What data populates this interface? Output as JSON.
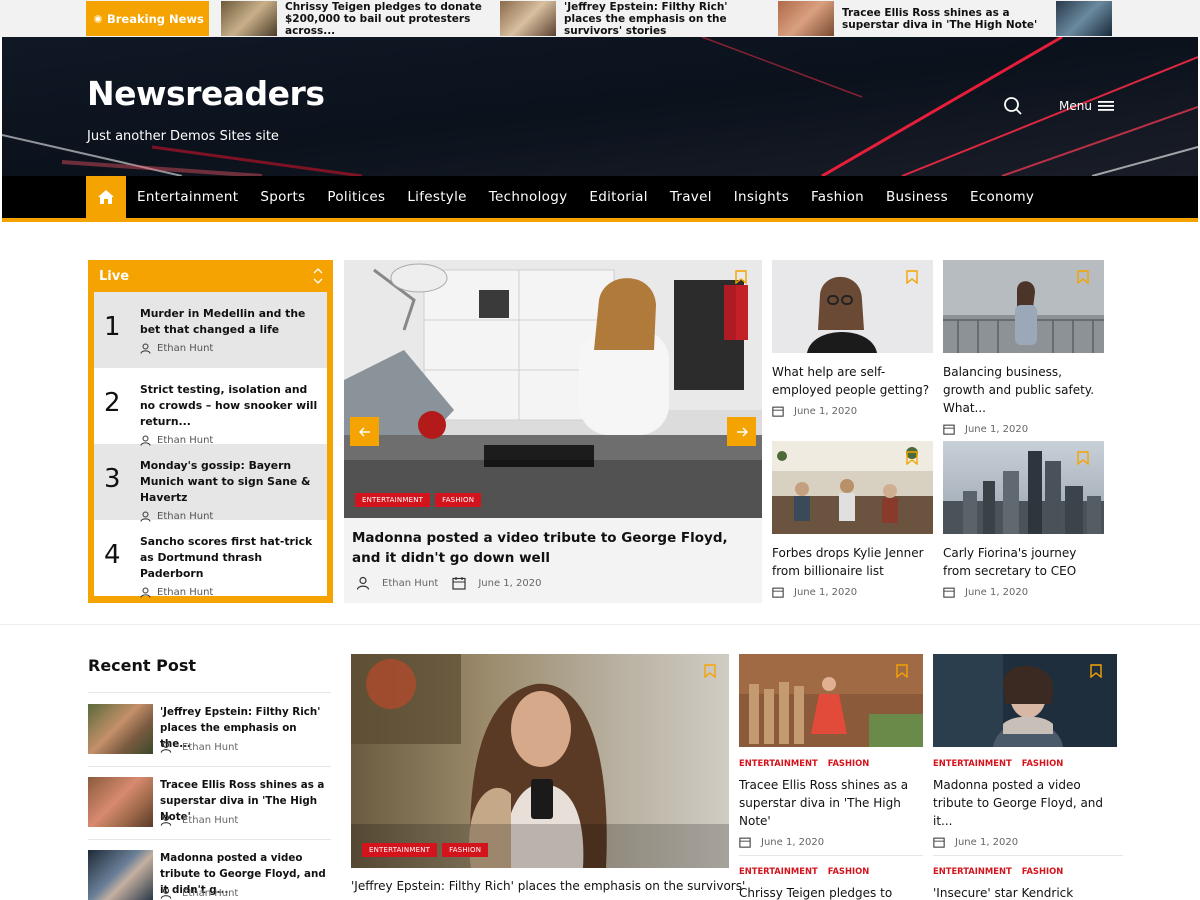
{
  "breaking": {
    "label": "Breaking News",
    "items": [
      {
        "title": "Chrissy Teigen pledges to donate $200,000 to bail out protesters across..."
      },
      {
        "title": "'Jeffrey Epstein: Filthy Rich' places the emphasis on the survivors' stories"
      },
      {
        "title": "Tracee Ellis Ross shines as a superstar diva in 'The High Note'"
      }
    ]
  },
  "header": {
    "site_title": "Newsreaders",
    "tagline": "Just another Demos Sites site",
    "menu_label": "Menu"
  },
  "nav": {
    "items": [
      "Entertainment",
      "Sports",
      "Politices",
      "Lifestyle",
      "Technology",
      "Editorial",
      "Travel",
      "Insights",
      "Fashion",
      "Business",
      "Economy"
    ]
  },
  "live": {
    "label": "Live",
    "items": [
      {
        "num": "1",
        "title": "Murder in Medellin and the bet that changed a life",
        "author": "Ethan Hunt"
      },
      {
        "num": "2",
        "title": "Strict testing, isolation and no crowds – how snooker will return...",
        "author": "Ethan Hunt"
      },
      {
        "num": "3",
        "title": "Monday's gossip: Bayern Munich want to sign Sane & Havertz",
        "author": "Ethan Hunt"
      },
      {
        "num": "4",
        "title": "Sancho scores first hat-trick as Dortmund thrash Paderborn",
        "author": "Ethan Hunt"
      }
    ]
  },
  "featured": {
    "badges": [
      "ENTERTAINMENT",
      "FASHION"
    ],
    "title": "Madonna posted a video tribute to George Floyd, and it didn't go down well",
    "author": "Ethan Hunt",
    "date": "June 1, 2020"
  },
  "grid": [
    {
      "title": "What help are self-employed people getting?",
      "date": "June 1, 2020"
    },
    {
      "title": "Balancing business, growth and public safety. What...",
      "date": "June 1, 2020"
    },
    {
      "title": "Forbes drops Kylie Jenner from billionaire list",
      "date": "June 1, 2020"
    },
    {
      "title": "Carly Fiorina's journey from secretary to CEO",
      "date": "June 1, 2020"
    }
  ],
  "recent": {
    "heading": "Recent Post",
    "items": [
      {
        "title": "'Jeffrey Epstein: Filthy Rich' places the emphasis on the...",
        "author": "Ethan Hunt"
      },
      {
        "title": "Tracee Ellis Ross shines as a superstar diva in 'The High Note'",
        "author": "Ethan Hunt"
      },
      {
        "title": "Madonna posted a video tribute to George Floyd, and it didn't g...",
        "author": "Ethan Hunt"
      }
    ]
  },
  "bottom": {
    "big": {
      "badges": [
        "ENTERTAINMENT",
        "FASHION"
      ],
      "title": "'Jeffrey Epstein: Filthy Rich' places the emphasis on the survivors'"
    },
    "cards": [
      {
        "cats": [
          "ENTERTAINMENT",
          "FASHION"
        ],
        "title": "Tracee Ellis Ross shines as a superstar diva in 'The High Note'",
        "date": "June 1, 2020"
      },
      {
        "cats": [
          "ENTERTAINMENT",
          "FASHION"
        ],
        "title": "Madonna posted a video tribute to George Floyd, and it...",
        "date": "June 1, 2020"
      },
      {
        "cats": [
          "ENTERTAINMENT",
          "FASHION"
        ],
        "title": "Chrissy Teigen pledges to"
      },
      {
        "cats": [
          "ENTERTAINMENT",
          "FASHION"
        ],
        "title": "'Insecure' star Kendrick"
      }
    ]
  },
  "colors": {
    "accent": "#f5a300",
    "badge": "#d4141d",
    "nav_bg": "#000000"
  }
}
